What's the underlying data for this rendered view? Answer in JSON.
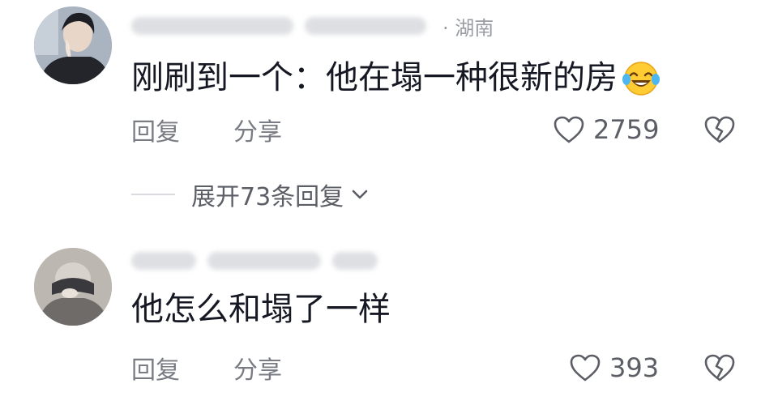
{
  "comments": [
    {
      "location": "· 湖南",
      "text": "刚刷到一个：他在塌一种很新的房",
      "emoji": "laughing-tears-emoji",
      "reply_label": "回复",
      "share_label": "分享",
      "like_count": "2759",
      "expand_label": "展开73条回复"
    },
    {
      "text": "他怎么和塌了一样",
      "reply_label": "回复",
      "share_label": "分享",
      "like_count": "393"
    }
  ],
  "icons": {
    "like": "heart-outline-icon",
    "dislike": "broken-heart-icon",
    "expand": "chevron-down-icon"
  },
  "colors": {
    "text": "#161823",
    "secondary": "#7a7c83",
    "divider": "#d9dadf",
    "background": "#ffffff"
  }
}
